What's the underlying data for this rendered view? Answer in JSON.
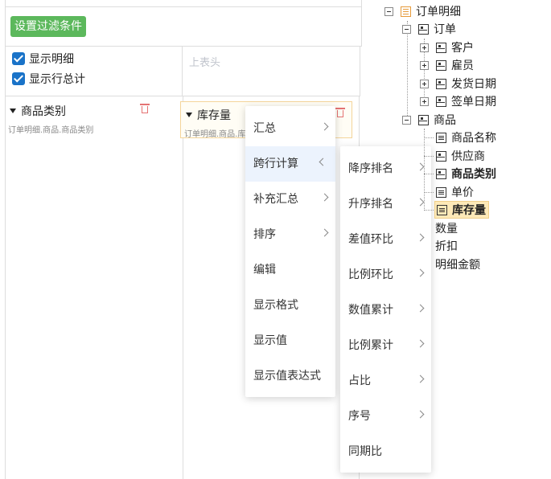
{
  "designer": {
    "filter_button": "设置过滤条件",
    "show_detail_label": "显示明细",
    "show_detail_checked": true,
    "show_row_total_label": "显示行总计",
    "show_row_total_checked": true,
    "column_header_placeholder": "上表头"
  },
  "row_field": {
    "label": "商品类别",
    "path": "订单明细.商品.商品类别"
  },
  "data_field": {
    "label": "库存量",
    "path": "订单明细.商品.库存量"
  },
  "context_menu": {
    "items": [
      {
        "label": "汇总",
        "has_submenu": true
      },
      {
        "label": "跨行计算",
        "has_submenu": true,
        "active": true
      },
      {
        "label": "补充汇总",
        "has_submenu": true
      },
      {
        "label": "排序",
        "has_submenu": true
      },
      {
        "label": "编辑",
        "has_submenu": false
      },
      {
        "label": "显示格式",
        "has_submenu": false
      },
      {
        "label": "显示值",
        "has_submenu": false
      },
      {
        "label": "显示值表达式",
        "has_submenu": false
      }
    ]
  },
  "submenu": {
    "items": [
      {
        "label": "降序排名",
        "has_submenu": true
      },
      {
        "label": "升序排名",
        "has_submenu": true
      },
      {
        "label": "差值环比",
        "has_submenu": true
      },
      {
        "label": "比例环比",
        "has_submenu": true
      },
      {
        "label": "数值累计",
        "has_submenu": true
      },
      {
        "label": "比例累计",
        "has_submenu": true
      },
      {
        "label": "占比",
        "has_submenu": true
      },
      {
        "label": "序号",
        "has_submenu": true
      },
      {
        "label": "同期比",
        "has_submenu": false
      }
    ]
  },
  "tree": {
    "root": "订单明细",
    "order": "订单",
    "order_children": [
      "客户",
      "雇员",
      "发货日期",
      "签单日期"
    ],
    "product": "商品",
    "product_children": [
      "商品名称",
      "供应商",
      "商品类别",
      "单价",
      "库存量"
    ],
    "measures": [
      "数量",
      "折扣",
      "明细金额"
    ]
  },
  "colors": {
    "accent_green": "#5cb85c",
    "checkbox_blue": "#1a73c8",
    "delete_red": "#e57373",
    "selected_bg": "#fde9b8"
  }
}
